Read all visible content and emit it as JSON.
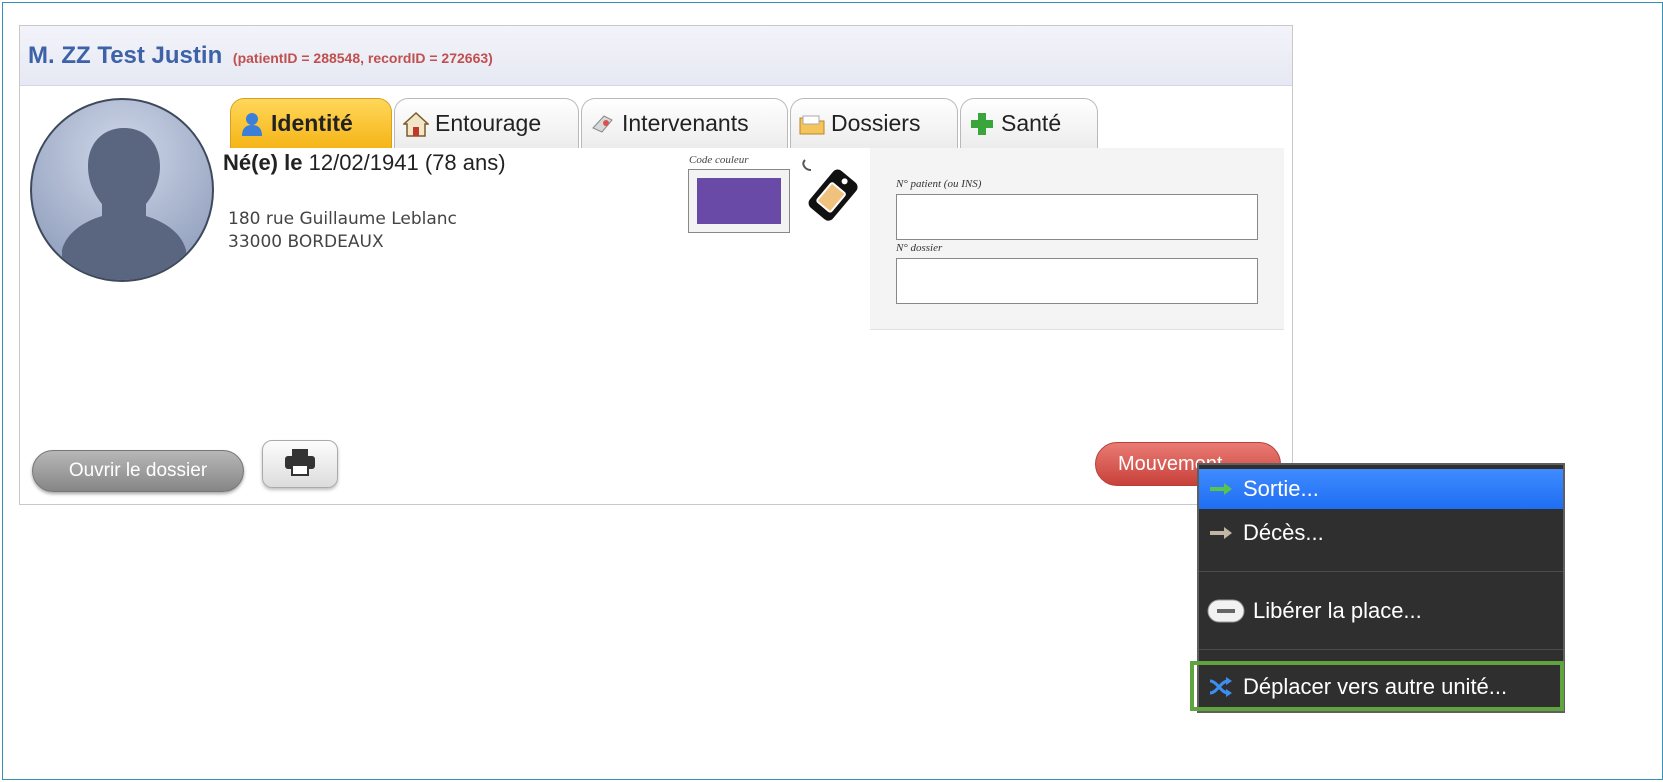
{
  "header": {
    "name": "M. ZZ Test Justin",
    "ids": "(patientID = 288548, recordID = 272663)"
  },
  "tabs": [
    {
      "label": "Identité",
      "icon": "person-icon",
      "active": true
    },
    {
      "label": "Entourage",
      "icon": "house-icon",
      "active": false
    },
    {
      "label": "Intervenants",
      "icon": "pin-icon",
      "active": false
    },
    {
      "label": "Dossiers",
      "icon": "folder-icon",
      "active": false
    },
    {
      "label": "Santé",
      "icon": "plus-icon",
      "active": false
    }
  ],
  "identity": {
    "born_label": "Né(e) le",
    "born_value": "12/02/1941 (78 ans)",
    "address_line1": "180 rue Guillaume Leblanc",
    "address_line2": "33000 BORDEAUX"
  },
  "color_code": {
    "label": "Code couleur",
    "color": "#6a4aa7"
  },
  "id_fields": {
    "patient_label": "N° patient (ou INS)",
    "patient_value": "",
    "dossier_label": "N° dossier",
    "dossier_value": ""
  },
  "buttons": {
    "open": "Ouvrir le dossier",
    "move": "Mouvement..."
  },
  "menu": {
    "items": [
      {
        "label": "Sortie...",
        "icon": "green-arrow-icon"
      },
      {
        "label": "Décès...",
        "icon": "gray-arrow-icon"
      },
      {
        "label": "Libérer la place...",
        "icon": "minus-pill-icon"
      },
      {
        "label": "Déplacer vers autre unité...",
        "icon": "shuffle-icon"
      }
    ]
  },
  "colors": {
    "accent_blue": "#3d62a8",
    "ids_red": "#c0504d",
    "active_tab": "#f5b517",
    "menu_hover": "#1f6ef3",
    "highlight_green": "#5fa43f"
  }
}
